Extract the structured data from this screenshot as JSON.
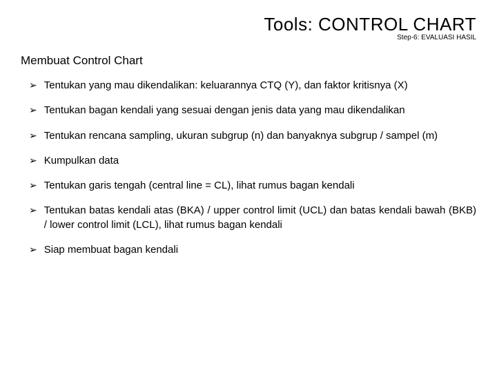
{
  "header": {
    "title": "Tools: CONTROL CHART",
    "subtitle": "Step-6: EVALUASI HASIL"
  },
  "section_heading": "Membuat Control Chart",
  "bullets": [
    "Tentukan yang mau dikendalikan: keluarannya CTQ (Y), dan faktor kritisnya (X)",
    "Tentukan bagan kendali yang sesuai dengan jenis data yang mau dikendalikan",
    "Tentukan rencana sampling, ukuran subgrup (n) dan banyaknya subgrup / sampel (m)",
    "Kumpulkan data",
    "Tentukan garis tengah (central line = CL), lihat rumus bagan kendali",
    "Tentukan batas kendali atas (BKA) / upper control limit (UCL) dan batas kendali bawah (BKB) / lower control limit (LCL), lihat rumus bagan kendali",
    "Siap membuat bagan kendali"
  ]
}
